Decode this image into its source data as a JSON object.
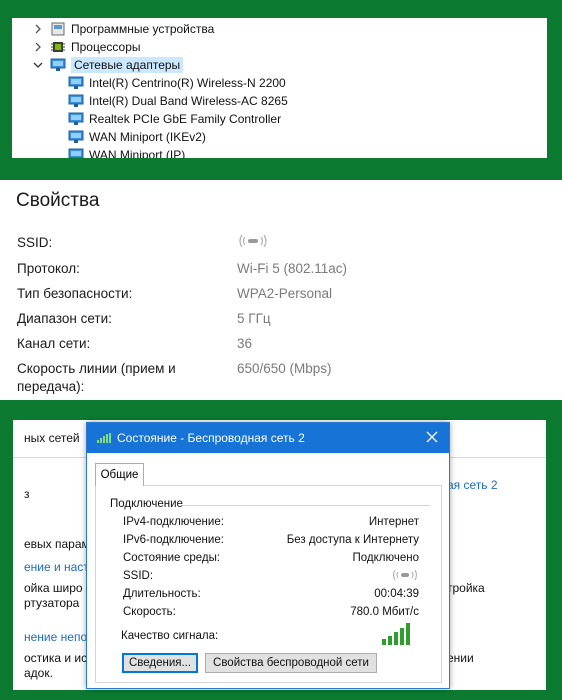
{
  "device_manager": {
    "items": [
      {
        "label": "Программные устройства",
        "expanded": false,
        "icon": "software-device-icon"
      },
      {
        "label": "Процессоры",
        "expanded": false,
        "icon": "processor-icon"
      },
      {
        "label": "Сетевые адаптеры",
        "expanded": true,
        "selected": true,
        "icon": "network-adapter-icon"
      }
    ],
    "adapters": [
      "Intel(R) Centrino(R) Wireless-N 2200",
      "Intel(R) Dual Band Wireless-AC 8265",
      "Realtek PCIe GbE Family Controller",
      "WAN Miniport (IKEv2)",
      "WAN Miniport (IP)"
    ]
  },
  "properties": {
    "title": "Свойства",
    "rows": [
      {
        "label": "SSID:",
        "value": "",
        "value_icon": "hidden-ssid-icon"
      },
      {
        "label": "Протокол:",
        "value": "Wi-Fi 5 (802.11ac)"
      },
      {
        "label": "Тип безопасности:",
        "value": "WPA2-Personal"
      },
      {
        "label": "Диапазон сети:",
        "value": "5 ГГц"
      },
      {
        "label": "Канал сети:",
        "value": "36"
      },
      {
        "label": "Скорость линии (прием и передача):",
        "value": "650/650 (Mbps)"
      }
    ]
  },
  "background_window": {
    "fragments": [
      "ных сетей",
      "з",
      "евых парам",
      "ение и настр",
      "ойка широ",
      "ртузатора",
      "нение непо",
      "остика и ис",
      "адок.",
      "ая сеть 2",
      "тройка",
      "ении"
    ]
  },
  "status_dialog": {
    "title": "Состояние - Беспроводная сеть 2",
    "tab": "Общие",
    "group": "Подключение",
    "rows": [
      {
        "label": "IPv4-подключение:",
        "value": "Интернет"
      },
      {
        "label": "IPv6-подключение:",
        "value": "Без доступа к Интернету"
      },
      {
        "label": "Состояние среды:",
        "value": "Подключено"
      },
      {
        "label": "SSID:",
        "value": "",
        "value_icon": "hidden-ssid-icon"
      },
      {
        "label": "Длительность:",
        "value": "00:04:39"
      },
      {
        "label": "Скорость:",
        "value": "780.0 Мбит/с"
      }
    ],
    "signal_label": "Качество сигнала:",
    "signal_bars": 5,
    "buttons": {
      "details": "Сведения...",
      "wireless_props": "Свойства беспроводной сети"
    }
  },
  "colors": {
    "frame_green": "#0b7a30",
    "titlebar_blue": "#1773d6",
    "signal_green": "#2f9e2f",
    "link_blue": "#1b6ac9",
    "selection": "#cce8ff"
  }
}
